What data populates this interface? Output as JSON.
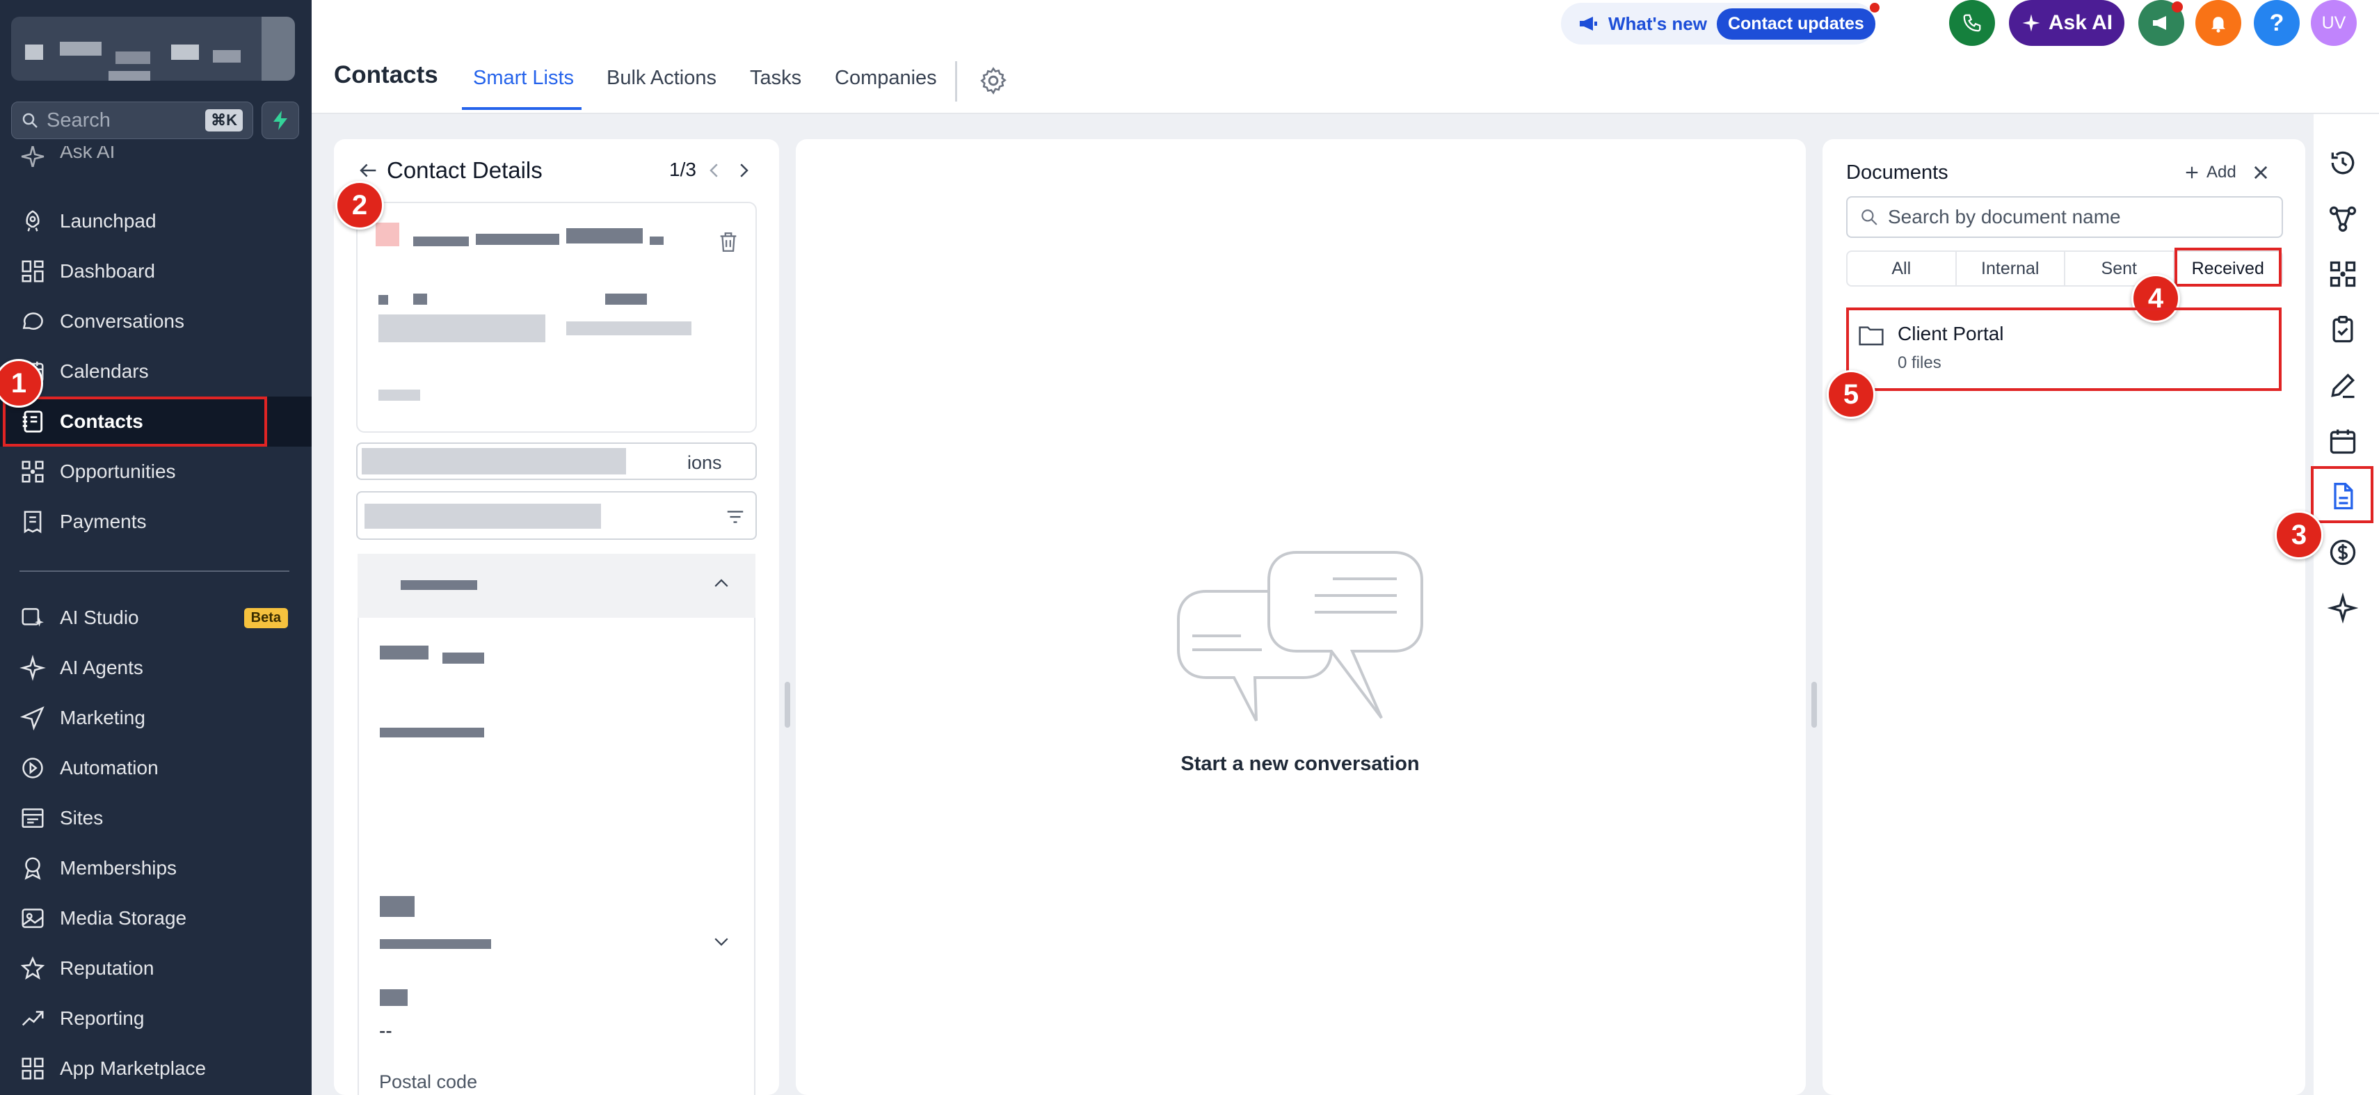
{
  "sidebar": {
    "search_placeholder": "Search",
    "search_shortcut": "⌘K",
    "partial_item": "Ask AI",
    "items": [
      {
        "label": "Launchpad",
        "icon": "rocket-icon"
      },
      {
        "label": "Dashboard",
        "icon": "grid-icon"
      },
      {
        "label": "Conversations",
        "icon": "chat-icon"
      },
      {
        "label": "Calendars",
        "icon": "calendar-icon"
      },
      {
        "label": "Contacts",
        "icon": "contact-book-icon",
        "active": true
      },
      {
        "label": "Opportunities",
        "icon": "opportunities-icon"
      },
      {
        "label": "Payments",
        "icon": "receipt-icon"
      }
    ],
    "items2": [
      {
        "label": "AI Studio",
        "icon": "ai-studio-icon",
        "badge": "Beta"
      },
      {
        "label": "AI Agents",
        "icon": "sparkle-icon"
      },
      {
        "label": "Marketing",
        "icon": "send-icon"
      },
      {
        "label": "Automation",
        "icon": "automation-icon"
      },
      {
        "label": "Sites",
        "icon": "sites-icon"
      },
      {
        "label": "Memberships",
        "icon": "award-icon"
      },
      {
        "label": "Media Storage",
        "icon": "image-icon"
      },
      {
        "label": "Reputation",
        "icon": "star-icon"
      },
      {
        "label": "Reporting",
        "icon": "trend-icon"
      },
      {
        "label": "App Marketplace",
        "icon": "apps-icon"
      }
    ]
  },
  "header": {
    "title": "Contacts",
    "tabs": [
      "Smart Lists",
      "Bulk Actions",
      "Tasks",
      "Companies"
    ],
    "active_tab": "Smart Lists",
    "whats_new": "What's new",
    "contact_updates": "Contact updates",
    "ask_ai": "Ask AI",
    "help": "?",
    "avatar_initials": "UV"
  },
  "contact_details": {
    "title": "Contact Details",
    "pager": "1/3",
    "partial_button_text": "ions",
    "empty_value": "--",
    "postal_label": "Postal code"
  },
  "conversation": {
    "empty_text": "Start a new conversation"
  },
  "documents": {
    "title": "Documents",
    "add_label": "Add",
    "search_placeholder": "Search by document name",
    "filters": [
      "All",
      "Internal",
      "Sent",
      "Received"
    ],
    "selected_filter": "Received",
    "folders": [
      {
        "name": "Client Portal",
        "count": "0 files"
      }
    ]
  },
  "annotations": [
    "1",
    "2",
    "3",
    "4",
    "5"
  ],
  "colors": {
    "sidebar_bg": "#212c3f",
    "accent_blue": "#2563eb",
    "annotation_red": "#e0251b",
    "ask_ai_purple": "#4c1d95"
  }
}
